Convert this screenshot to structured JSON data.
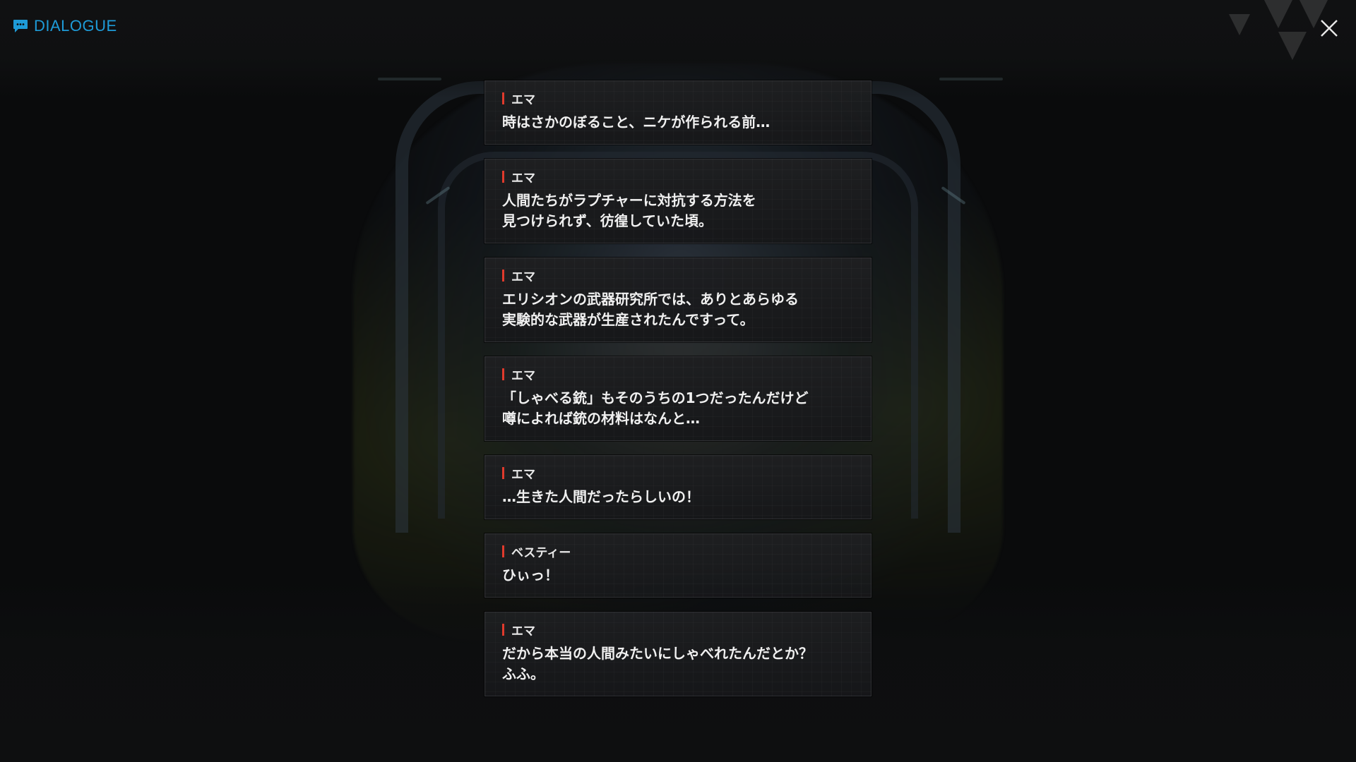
{
  "header": {
    "title": "DIALOGUE",
    "icon": "chat-bubble-icon",
    "accent_color": "#1e9bd8"
  },
  "close": {
    "icon": "close-icon"
  },
  "speaker_bar_color": "#e03a2c",
  "dialogue": [
    {
      "speaker": "エマ",
      "text": "時はさかのぼること、ニケが作られる前…"
    },
    {
      "speaker": "エマ",
      "text": "人間たちがラプチャーに対抗する方法を\n見つけられず、彷徨していた頃。"
    },
    {
      "speaker": "エマ",
      "text": "エリシオンの武器研究所では、ありとあらゆる\n実験的な武器が生産されたんですって。"
    },
    {
      "speaker": "エマ",
      "text": "「しゃべる銃」もそのうちの1つだったんだけど\n噂によれば銃の材料はなんと…"
    },
    {
      "speaker": "エマ",
      "text": "…生きた人間だったらしいの！"
    },
    {
      "speaker": "ベスティー",
      "text": "ひぃっ！"
    },
    {
      "speaker": "エマ",
      "text": "だから本当の人間みたいにしゃべれたんだとか？\nふふ。"
    }
  ]
}
